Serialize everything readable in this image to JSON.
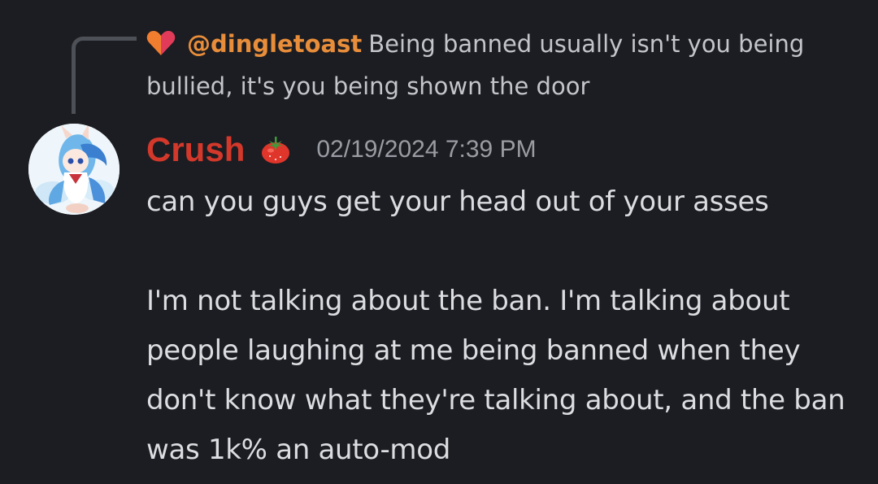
{
  "reply": {
    "author": "@dingletoast",
    "text": "Being banned usually isn't you being bullied, it's you being shown the door",
    "icon": "orange-pink-heart-icon"
  },
  "message": {
    "author": "Crush",
    "author_color": "#d3382b",
    "badge_icon": "tomato-icon",
    "timestamp": "02/19/2024 7:39 PM",
    "lines": [
      "can you guys get your head out of your asses",
      "I'm not talking about the ban. I'm talking about people laughing at me being banned when they don't know what they're talking about, and the ban was 1k% an auto-mod"
    ]
  },
  "colors": {
    "background": "#1c1d22",
    "reply_author": "#e88d3a",
    "text": "#dcdde1",
    "timestamp": "#9a9ca3"
  }
}
